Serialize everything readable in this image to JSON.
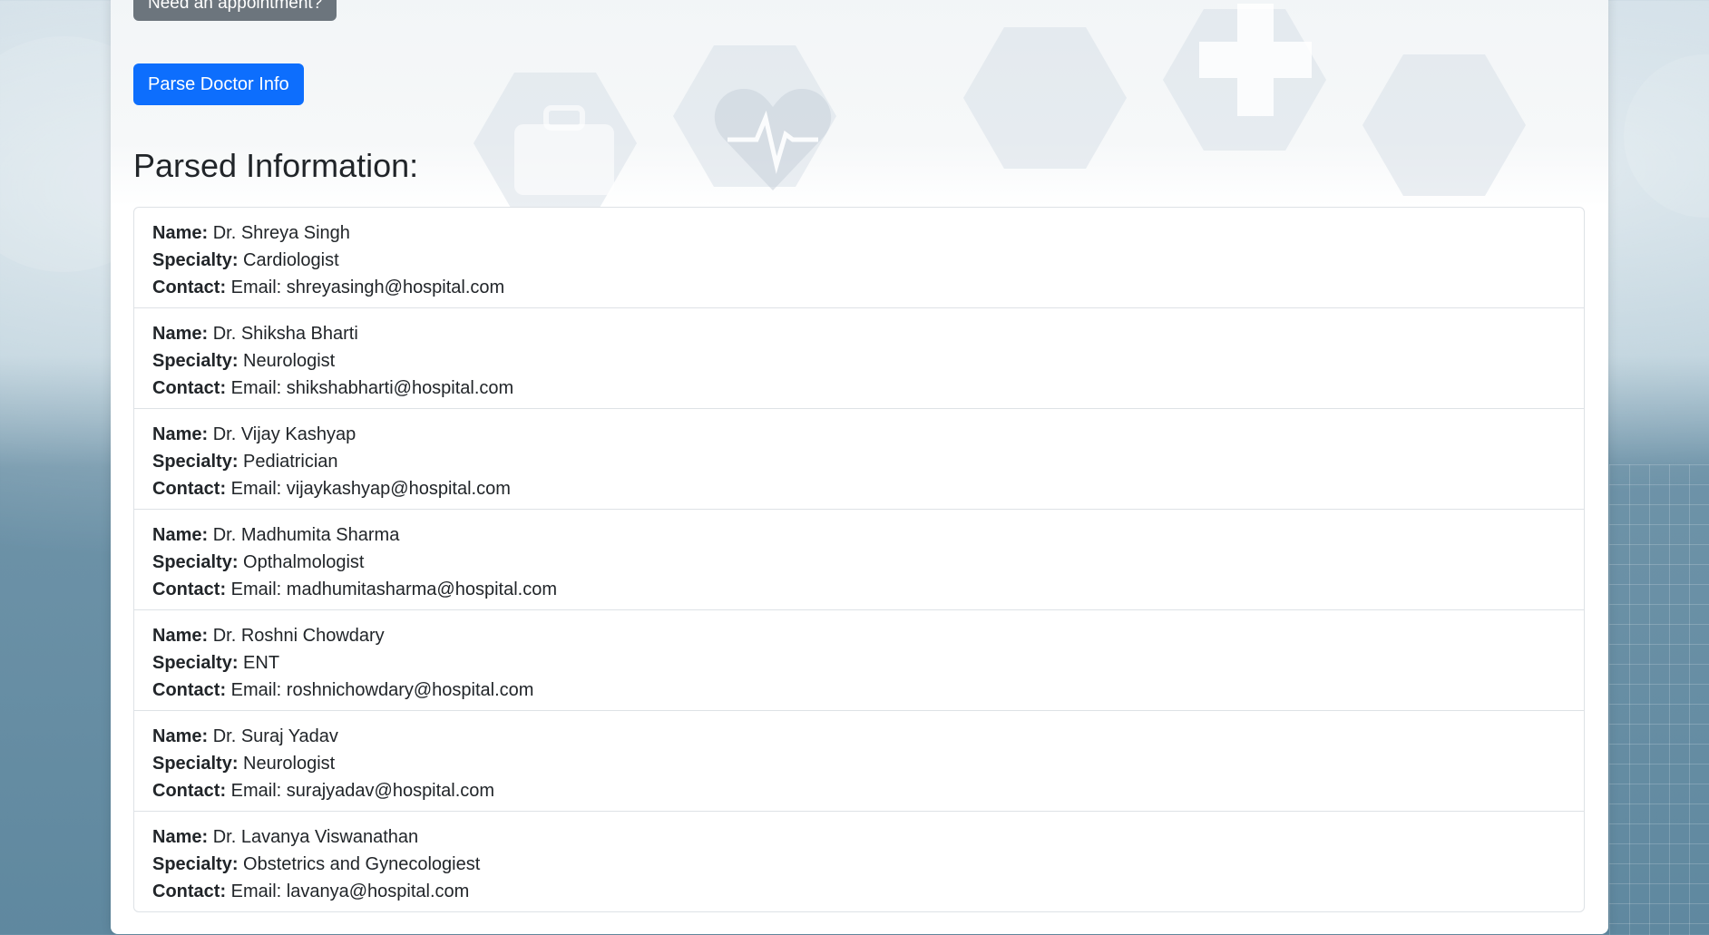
{
  "appointment_button": "Need an appointment?",
  "parse_button": "Parse Doctor Info",
  "section_title": "Parsed Information:",
  "field_labels": {
    "name": "Name:",
    "specialty": "Specialty:",
    "contact": "Contact:"
  },
  "doctors": [
    {
      "name": "Dr. Shreya Singh",
      "specialty": "Cardiologist",
      "contact": "Email: shreyasingh@hospital.com"
    },
    {
      "name": "Dr. Shiksha Bharti",
      "specialty": "Neurologist",
      "contact": "Email: shikshabharti@hospital.com"
    },
    {
      "name": "Dr. Vijay Kashyap",
      "specialty": "Pediatrician",
      "contact": "Email: vijaykashyap@hospital.com"
    },
    {
      "name": "Dr. Madhumita Sharma",
      "specialty": "Opthalmologist",
      "contact": "Email: madhumitasharma@hospital.com"
    },
    {
      "name": "Dr. Roshni Chowdary",
      "specialty": "ENT",
      "contact": "Email: roshnichowdary@hospital.com"
    },
    {
      "name": "Dr. Suraj Yadav",
      "specialty": "Neurologist",
      "contact": "Email: surajyadav@hospital.com"
    },
    {
      "name": "Dr. Lavanya Viswanathan",
      "specialty": "Obstetrics and Gynecologiest",
      "contact": "Email: lavanya@hospital.com"
    }
  ],
  "colors": {
    "primary": "#0d6efd",
    "secondary": "#6c757d",
    "border": "#dee2e6",
    "text": "#212529"
  },
  "icons": [
    "heart-pulse-icon",
    "medical-cross-icon",
    "first-aid-kit-icon"
  ]
}
